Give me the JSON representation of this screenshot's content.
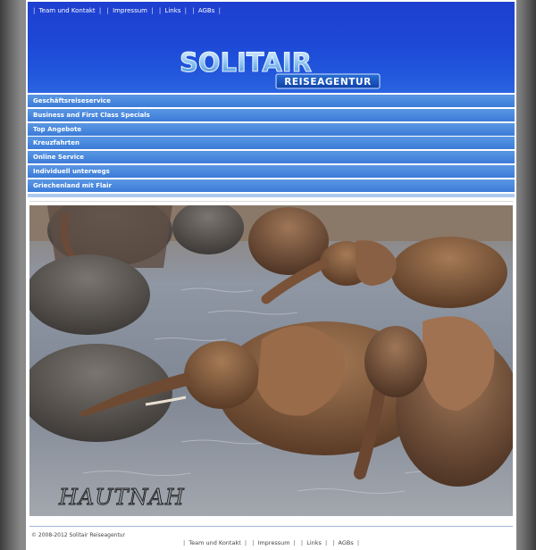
{
  "top_nav": {
    "items": [
      "Team und Kontakt",
      "Impressum",
      "Links",
      "AGBs"
    ]
  },
  "logo": {
    "title": "SOLITAIR",
    "subtitle": "REISEAGENTUR"
  },
  "menu": {
    "items": [
      "Geschäftsreiseservice",
      "Business and First Class Specials",
      "Top Angebote",
      "Kreuzfahrten",
      "Online Service",
      "Individuell unterwegs",
      "Griechenland mit Flair"
    ]
  },
  "hero": {
    "caption": "HAUTNAH"
  },
  "footer": {
    "copyright": "© 2008-2012 Solitair Reiseagentur",
    "links": [
      "Team und Kontakt",
      "Impressum",
      "Links",
      "AGBs"
    ]
  },
  "colors": {
    "header_blue": "#1e48d6",
    "menu_blue": "#3a7bd8",
    "page_background": "#8a8a8a"
  }
}
